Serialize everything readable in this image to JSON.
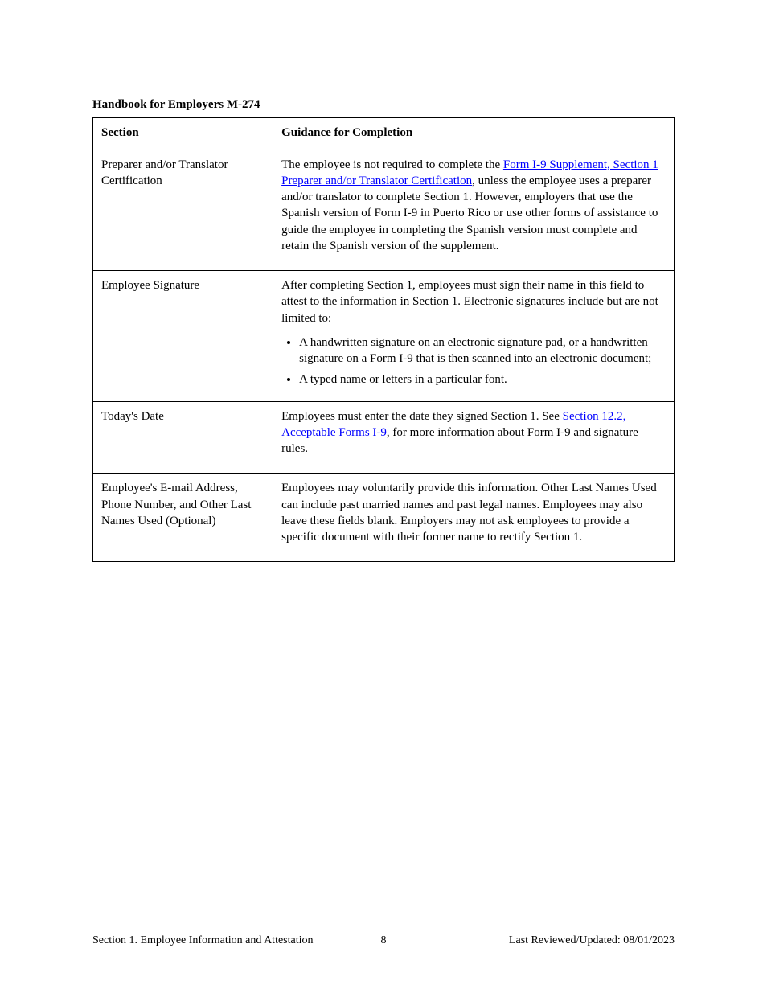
{
  "section_title": "Handbook for Employers M-274",
  "table": {
    "header": {
      "col1": "Section",
      "col2": "Guidance for Completion"
    },
    "rows": [
      {
        "label": "Preparer and/or Translator Certification",
        "desc": {
          "pre": "The employee is not required to complete the ",
          "link": "Form I-9 Supplement, Section 1 Preparer and/or Translator Certification",
          "post": ", unless the employee uses a preparer and/or translator to complete Section 1. However, employers that use the Spanish version of Form I-9 in Puerto Rico or use other forms of assistance to guide the employee in completing the Spanish version must complete and retain the Spanish version of the supplement."
        }
      },
      {
        "label": "Employee Signature",
        "intro": "After completing Section 1, employees must sign their name in this field to attest to the information in Section 1. Electronic signatures include but are not limited to:",
        "bullets": [
          "A handwritten signature on an electronic signature pad, or a handwritten signature on a Form I-9 that is then scanned into an electronic document;",
          "A typed name or letters in a particular font."
        ]
      },
      {
        "label": "Today's Date",
        "desc": {
          "pre": "Employees must enter the date they signed Section 1. See ",
          "link": "Section 12.2, Acceptable Forms I-9",
          "post": ", for more information about Form I-9 and signature rules."
        }
      },
      {
        "label": "Employee's E-mail Address, Phone Number, and Other Last Names Used (Optional)",
        "desc_plain": "Employees may voluntarily provide this information. Other Last Names Used can include past married names and past legal names. Employees may also leave these fields blank. Employers may not ask employees to provide a specific document with their former name to rectify Section 1."
      }
    ]
  },
  "footer": {
    "left": "Section 1. Employee Information and Attestation",
    "page": "8",
    "right": "Last Reviewed/Updated: 08/01/2023"
  }
}
